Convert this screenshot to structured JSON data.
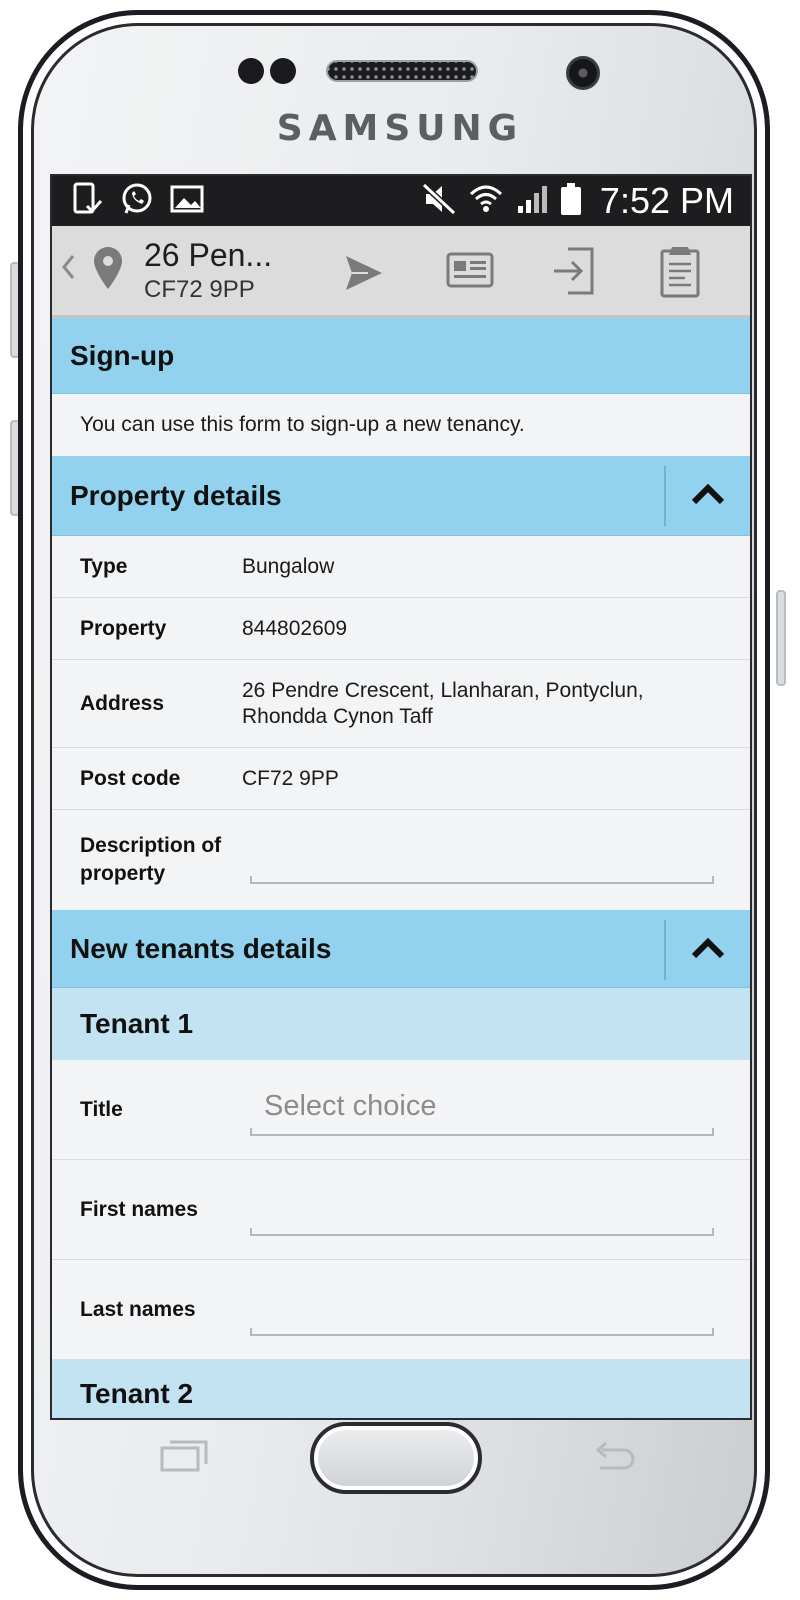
{
  "device": {
    "brand": "SAMSUNG"
  },
  "status_bar": {
    "time": "7:52 PM",
    "left_icons": [
      "device-check-icon",
      "whatsapp-icon",
      "gallery-icon"
    ],
    "right_icons": [
      "mute-icon",
      "wifi-icon",
      "signal-icon",
      "battery-icon"
    ]
  },
  "toolbar": {
    "title": "26 Pen...",
    "subtitle": "CF72 9PP",
    "actions": [
      "send-icon",
      "card-icon",
      "login-icon",
      "clipboard-icon"
    ]
  },
  "signup": {
    "title": "Sign-up",
    "intro": "You can use this form to sign-up a new tenancy."
  },
  "property_details": {
    "title": "Property details",
    "rows": [
      {
        "label": "Type",
        "value": "Bungalow"
      },
      {
        "label": "Property",
        "value": "844802609"
      },
      {
        "label": "Address",
        "value_line1": "26 Pendre Crescent, Llanharan, Pontyclun,",
        "value_line2": "Rhondda Cynon Taff"
      },
      {
        "label": "Post code",
        "value": "CF72 9PP"
      },
      {
        "label_line1": "Description of",
        "label_line2": "property",
        "value": ""
      }
    ]
  },
  "new_tenants": {
    "title": "New tenants details",
    "tenant1": {
      "title": "Tenant 1",
      "fields": [
        {
          "label": "Title",
          "placeholder": "Select choice"
        },
        {
          "label": "First names",
          "placeholder": ""
        },
        {
          "label": "Last names",
          "placeholder": ""
        }
      ]
    },
    "tenant2": {
      "title": "Tenant 2"
    }
  }
}
